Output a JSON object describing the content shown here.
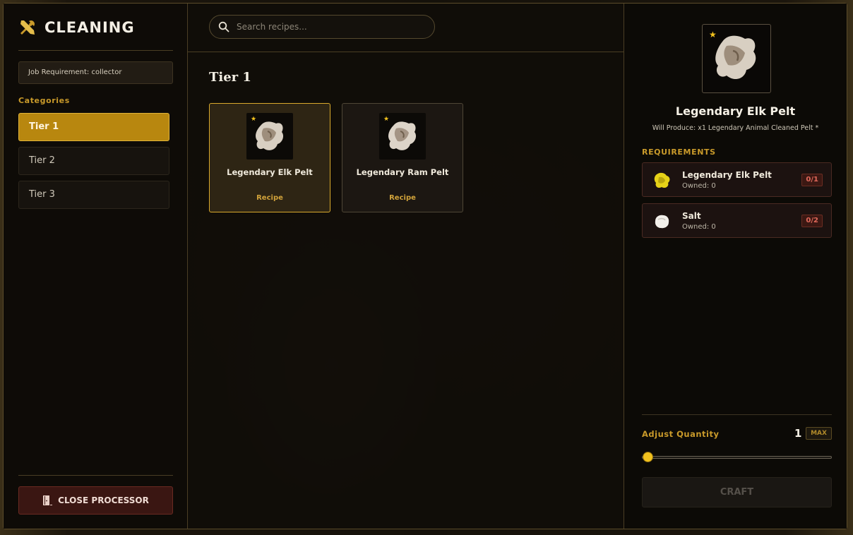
{
  "sidebar": {
    "title": "CLEANING",
    "job_requirement": "Job Requirement: collector",
    "categories_heading": "Categories",
    "categories": [
      {
        "label": "Tier 1",
        "active": true
      },
      {
        "label": "Tier 2",
        "active": false
      },
      {
        "label": "Tier 3",
        "active": false
      }
    ],
    "close_label": "CLOSE PROCESSOR"
  },
  "search": {
    "placeholder": "Search recipes..."
  },
  "main": {
    "tier_title": "Tier 1",
    "recipes": [
      {
        "name": "Legendary Elk Pelt",
        "type": "Recipe",
        "icon": "pelt-icon",
        "selected": true
      },
      {
        "name": "Legendary Ram Pelt",
        "type": "Recipe",
        "icon": "pelt-icon",
        "selected": false
      }
    ]
  },
  "detail": {
    "title": "Legendary Elk Pelt",
    "produce_note": "Will Produce: x1 Legendary Animal Cleaned Pelt *",
    "requirements_heading": "REQUIREMENTS",
    "requirements": [
      {
        "name": "Legendary Elk Pelt",
        "owned": "Owned: 0",
        "badge": "0/1",
        "icon": "yellow-pelt-icon"
      },
      {
        "name": "Salt",
        "owned": "Owned: 0",
        "badge": "0/2",
        "icon": "salt-icon"
      }
    ],
    "quantity_label": "Adjust Quantity",
    "quantity_value": "1",
    "max_label": "MAX",
    "craft_label": "CRAFT"
  },
  "colors": {
    "accent": "#b8870f",
    "accent_text": "#c99a2a",
    "danger": "#e0685a",
    "star": "#f2c21e"
  }
}
